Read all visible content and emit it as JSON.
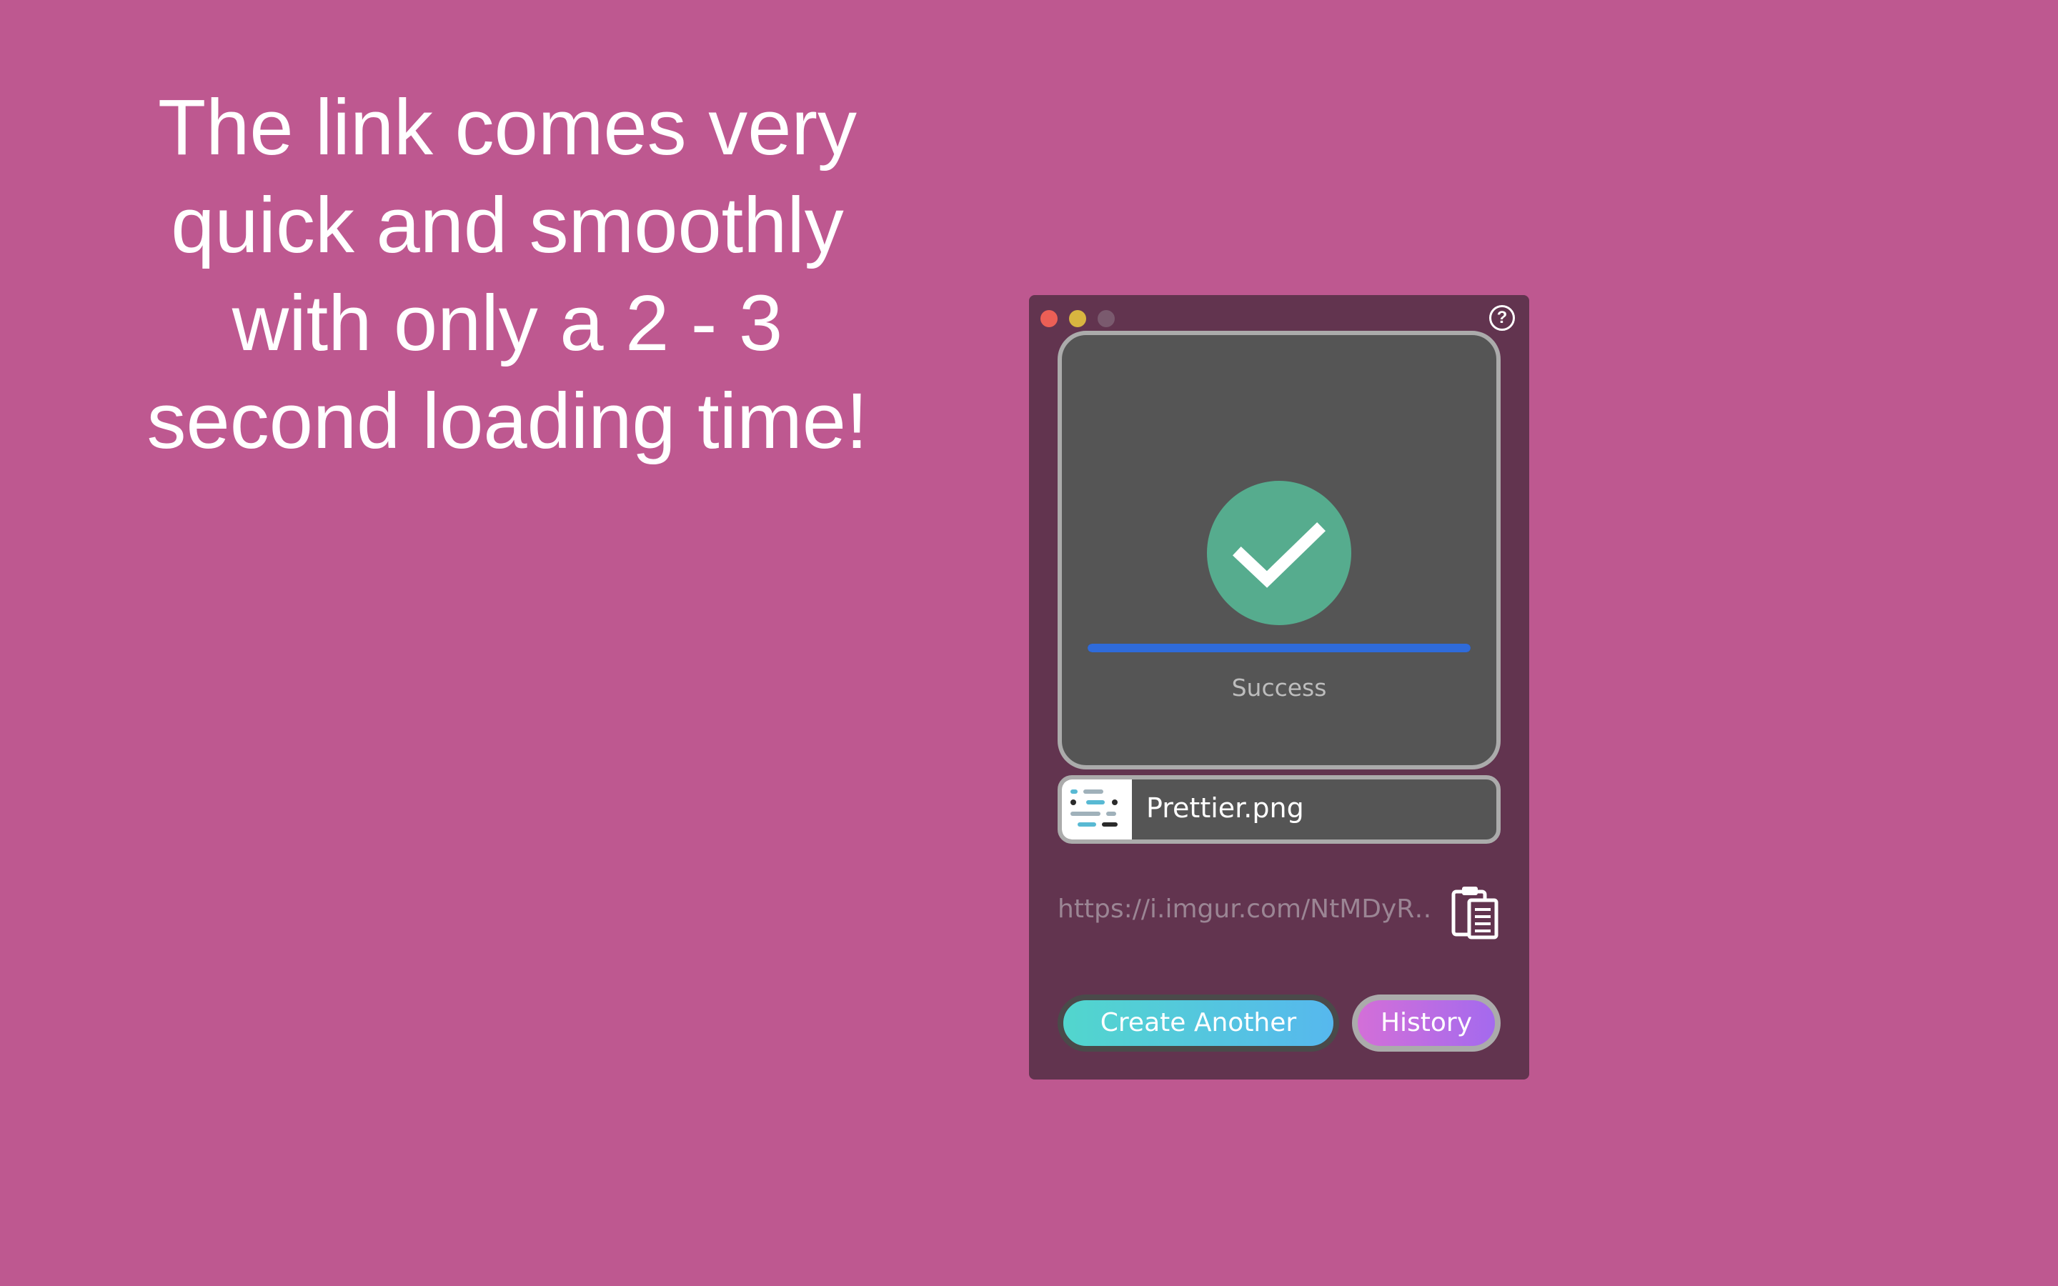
{
  "headline": {
    "lines": [
      "The link comes very",
      "quick and smoothly",
      "with only a 2 - 3",
      "second loading time!"
    ]
  },
  "window": {
    "controls": [
      "close",
      "minimize",
      "zoom"
    ],
    "help_icon": "question-circle-icon",
    "help_label": "?"
  },
  "upload": {
    "status": "Success",
    "status_icon": "checkmark-icon",
    "progress": 1.0,
    "colors": {
      "success": "#56AC8E",
      "progress": "#2F6BDA"
    }
  },
  "file": {
    "name": "Prettier.png",
    "thumbnail_icon": "image-thumbnail-icon"
  },
  "link": {
    "url": "https://i.imgur.com/NtMDyR…",
    "copy_icon": "clipboard-icon"
  },
  "actions": {
    "create_another": "Create Another",
    "history": "History"
  },
  "colors": {
    "background": "#BE5890",
    "window": "#62344F",
    "panel": "#555555"
  }
}
